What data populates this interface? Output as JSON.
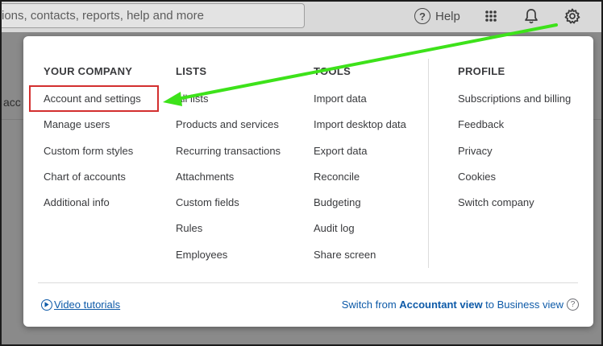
{
  "topbar": {
    "search_text": "ions, contacts, reports, help and more",
    "help_label": "Help"
  },
  "background": {
    "side_text": "acc"
  },
  "settings_menu": {
    "columns": [
      {
        "heading": "YOUR COMPANY",
        "items": [
          "Account and settings",
          "Manage users",
          "Custom form styles",
          "Chart of accounts",
          "Additional info"
        ]
      },
      {
        "heading": "LISTS",
        "items": [
          "All lists",
          "Products and services",
          "Recurring transactions",
          "Attachments",
          "Custom fields",
          "Rules",
          "Employees"
        ]
      },
      {
        "heading": "TOOLS",
        "items": [
          "Import data",
          "Import desktop data",
          "Export data",
          "Reconcile",
          "Budgeting",
          "Audit log",
          "Share screen"
        ]
      },
      {
        "heading": "PROFILE",
        "items": [
          "Subscriptions and billing",
          "Feedback",
          "Privacy",
          "Cookies",
          "Switch company"
        ]
      }
    ],
    "footer": {
      "video_tutorials": "Video tutorials",
      "switch_prefix": "Switch from ",
      "switch_bold": "Accountant view",
      "switch_suffix": " to Business view"
    }
  },
  "colors": {
    "link": "#0d5aa8",
    "highlight": "#d32f2f",
    "annotation_arrow": "#3de21a"
  },
  "icons": [
    "help-icon",
    "apps-grid-icon",
    "bell-icon",
    "gear-icon",
    "play-circle-icon",
    "question-circle-icon"
  ]
}
